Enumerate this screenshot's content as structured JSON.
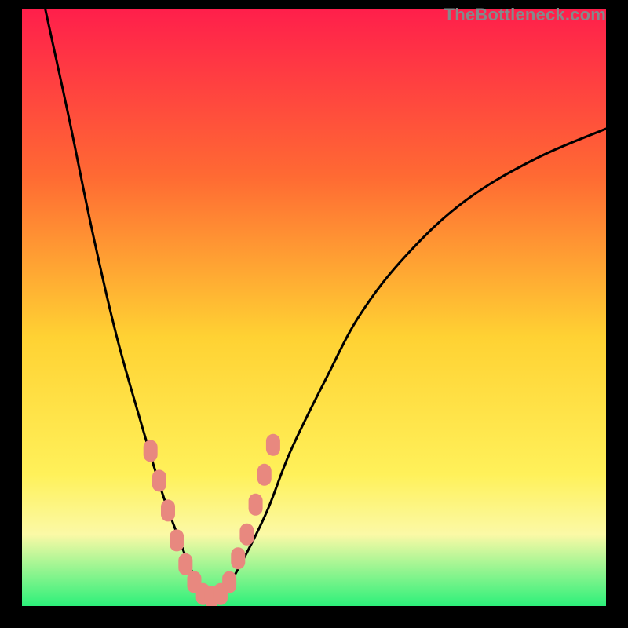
{
  "watermark": "TheBottleneck.com",
  "colors": {
    "gradient_top": "#ff1f4b",
    "gradient_mid1": "#ff7a2a",
    "gradient_mid2": "#ffe433",
    "gradient_mid3": "#fdf87a",
    "gradient_bottom": "#2df07a",
    "curve": "#000000",
    "markers": "#e8887f",
    "frame": "#000000"
  },
  "chart_data": {
    "type": "line",
    "title": "",
    "xlabel": "",
    "ylabel": "",
    "xlim": [
      0,
      100
    ],
    "ylim": [
      0,
      100
    ],
    "grid": false,
    "series": [
      {
        "name": "bottleneck-curve",
        "x": [
          4,
          8,
          12,
          16,
          20,
          24,
          27,
          29,
          31,
          33,
          35,
          38,
          42,
          46,
          52,
          58,
          66,
          76,
          88,
          100
        ],
        "y": [
          100,
          82,
          63,
          46,
          32,
          19,
          11,
          6,
          3,
          1.5,
          3,
          8,
          16,
          26,
          38,
          49,
          59,
          68,
          75,
          80
        ]
      }
    ],
    "markers": [
      {
        "x": 22,
        "y": 26
      },
      {
        "x": 23.5,
        "y": 21
      },
      {
        "x": 25,
        "y": 16
      },
      {
        "x": 26.5,
        "y": 11
      },
      {
        "x": 28,
        "y": 7
      },
      {
        "x": 29.5,
        "y": 4
      },
      {
        "x": 31,
        "y": 2
      },
      {
        "x": 32.5,
        "y": 1.5
      },
      {
        "x": 34,
        "y": 2
      },
      {
        "x": 35.5,
        "y": 4
      },
      {
        "x": 37,
        "y": 8
      },
      {
        "x": 38.5,
        "y": 12
      },
      {
        "x": 40,
        "y": 17
      },
      {
        "x": 41.5,
        "y": 22
      },
      {
        "x": 43,
        "y": 27
      }
    ]
  }
}
